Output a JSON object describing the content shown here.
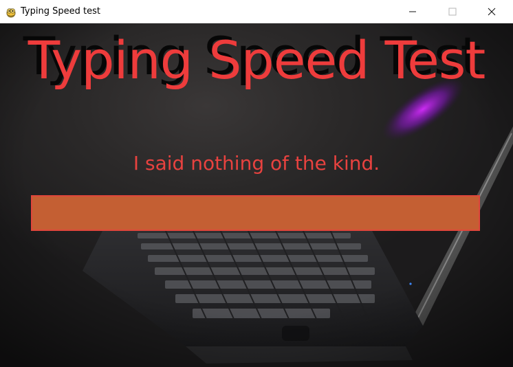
{
  "window": {
    "title": "Typing Speed test",
    "controls": {
      "minimize_icon": "minimize-icon",
      "maximize_icon": "maximize-icon",
      "close_icon": "close-icon"
    }
  },
  "game": {
    "heading": "Typing Speed Test",
    "sentence": "I said nothing of the kind.",
    "input_value": ""
  },
  "colors": {
    "heading": "#ee3c3c",
    "sentence": "#e8423f",
    "input_fill": "#c45f33",
    "input_border": "#e0463b",
    "background": "#1c1b1c"
  }
}
